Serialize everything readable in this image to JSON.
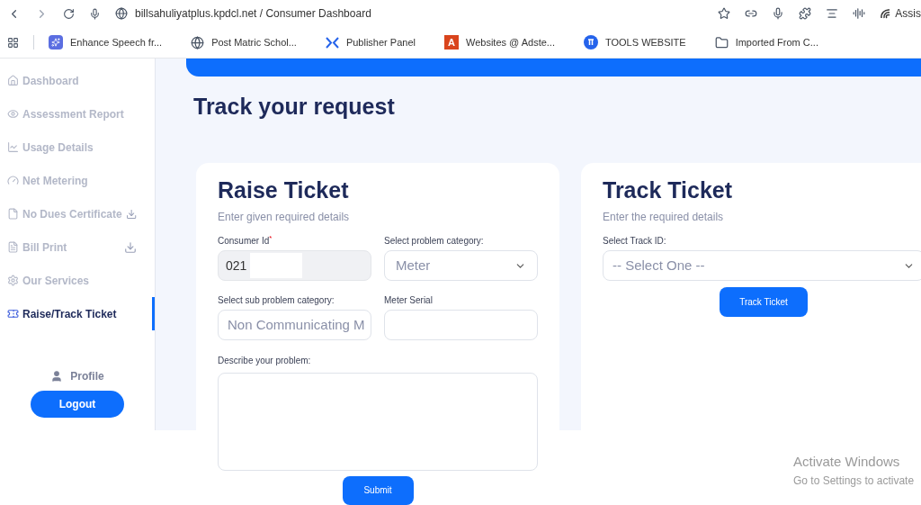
{
  "browser": {
    "address": "billsahuliyatplus.kpdcl.net / Consumer Dashboard",
    "profile_label": "Assis",
    "bookmarks": [
      {
        "kind": "speech",
        "label": "Enhance Speech fr..."
      },
      {
        "kind": "globe",
        "label": "Post Matric Schol..."
      },
      {
        "kind": "chevrons",
        "label": "Publisher Panel"
      },
      {
        "kind": "letter",
        "label": "Websites @ Adste..."
      },
      {
        "kind": "tools",
        "label": "TOOLS WEBSITE"
      },
      {
        "kind": "folder",
        "label": "Imported From C..."
      }
    ],
    "bookmark_badge": "A"
  },
  "sidebar": {
    "items": [
      {
        "kind": "home",
        "label": "Dashboard",
        "selected": false,
        "download": false
      },
      {
        "kind": "eye",
        "label": "Assessment Report",
        "selected": false,
        "download": false
      },
      {
        "kind": "chart",
        "label": "Usage Details",
        "selected": false,
        "download": false
      },
      {
        "kind": "gauge",
        "label": "Net Metering",
        "selected": false,
        "download": false
      },
      {
        "kind": "file",
        "label": "No Dues Certificate",
        "selected": false,
        "download": true
      },
      {
        "kind": "doc",
        "label": "Bill Print",
        "selected": false,
        "download": true
      },
      {
        "kind": "gears",
        "label": "Our Services",
        "selected": false,
        "download": false
      },
      {
        "kind": "ticket",
        "label": "Raise/Track Ticket",
        "selected": true,
        "download": false
      }
    ],
    "profile": "Profile",
    "logout": "Logout"
  },
  "page_title": "Track your request",
  "raise": {
    "title": "Raise Ticket",
    "subtitle": "Enter given required details",
    "consumer_id": {
      "label": "Consumer Id",
      "required_mark": "*",
      "value": "021"
    },
    "category": {
      "label": "Select problem category:",
      "value": "Meter"
    },
    "sub_category": {
      "label": "Select sub problem category:",
      "value": "Non Communicating M"
    },
    "meter_serial": {
      "label": "Meter Serial"
    },
    "description": {
      "label": "Describe your problem:"
    },
    "submit": "Submit"
  },
  "track": {
    "title": "Track Ticket",
    "subtitle": "Enter the required details",
    "track_id": {
      "label": "Select Track ID:",
      "value": "-- Select One --"
    },
    "button": "Track Ticket"
  },
  "os_notice": {
    "title": "Activate Windows",
    "text": "Go to Settings to activate"
  }
}
